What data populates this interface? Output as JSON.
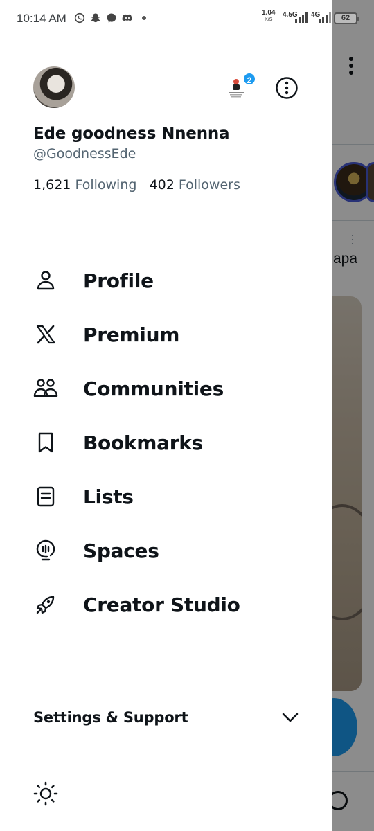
{
  "status_bar": {
    "time": "10:14 AM",
    "speed_value": "1.04",
    "speed_unit": "K/S",
    "network_1": "4.5G",
    "network_2": "4G",
    "battery": "62",
    "icons": [
      "whatsapp-icon",
      "snapchat-icon",
      "messenger-icon",
      "discord-icon"
    ]
  },
  "profile": {
    "display_name": "Ede goodness Nnenna",
    "handle": "@GoodnessEde",
    "following_count": "1,621",
    "following_label": "Following",
    "followers_count": "402",
    "followers_label": "Followers",
    "accounts_badge": "2"
  },
  "menu": [
    {
      "label": "Profile",
      "icon": "person-icon"
    },
    {
      "label": "Premium",
      "icon": "x-logo-icon"
    },
    {
      "label": "Communities",
      "icon": "communities-icon"
    },
    {
      "label": "Bookmarks",
      "icon": "bookmark-icon"
    },
    {
      "label": "Lists",
      "icon": "list-icon"
    },
    {
      "label": "Spaces",
      "icon": "spaces-icon"
    },
    {
      "label": "Creator Studio",
      "icon": "rocket-icon"
    }
  ],
  "settings": {
    "label": "Settings & Support"
  },
  "background": {
    "tweet_text_fragment": "apa"
  },
  "colors": {
    "accent": "#1d9bf0",
    "text_primary": "#0f1419",
    "text_secondary": "#536471"
  }
}
